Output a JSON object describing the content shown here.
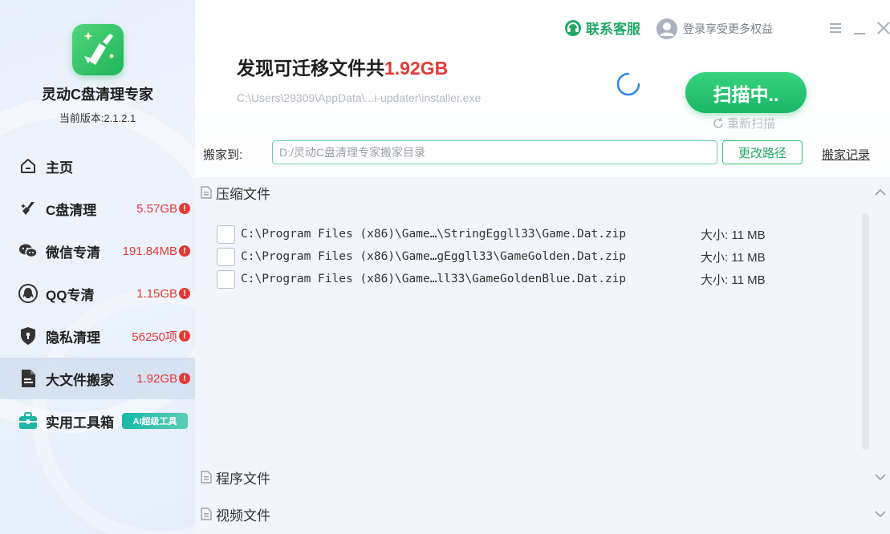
{
  "app": {
    "name": "灵动C盘清理专家",
    "version": "当前版本:2.1.2.1"
  },
  "sidebar": {
    "items": [
      {
        "label": "主页",
        "icon": "home-icon",
        "value": "",
        "active": false
      },
      {
        "label": "C盘清理",
        "icon": "broom-icon",
        "value": "5.57GB",
        "active": false
      },
      {
        "label": "微信专清",
        "icon": "wechat-icon",
        "value": "191.84MB",
        "active": false
      },
      {
        "label": "QQ专清",
        "icon": "qq-icon",
        "value": "1.15GB",
        "active": false
      },
      {
        "label": "隐私清理",
        "icon": "shield-icon",
        "value": "56250项",
        "active": false
      },
      {
        "label": "大文件搬家",
        "icon": "file-move-icon",
        "value": "1.92GB",
        "active": true
      },
      {
        "label": "实用工具箱",
        "icon": "toolbox-icon",
        "value": "",
        "tag": "AI超级工具",
        "active": false
      }
    ]
  },
  "topbar": {
    "service": "联系客服",
    "login": "登录享受更多权益"
  },
  "header": {
    "headline_prefix": "发现可迁移文件共",
    "headline_size": "1.92GB",
    "scan_path": "C:\\Users\\29309\\AppData\\...i-updater\\installer.exe",
    "scan_button": "扫描中..",
    "rescan": "重新扫描"
  },
  "move": {
    "label": "搬家到:",
    "path": "D:/灵动C盘清理专家搬家目录",
    "change_button": "更改路径",
    "log_link": "搬家记录"
  },
  "groups": [
    {
      "title": "压缩文件",
      "expanded": true,
      "files": [
        {
          "path": "C:\\Program Files (x86)\\Game…\\StringEggll33\\Game.Dat.zip",
          "size": "大小: 11 MB"
        },
        {
          "path": "C:\\Program Files (x86)\\Game…gEggll33\\GameGolden.Dat.zip",
          "size": "大小: 11 MB"
        },
        {
          "path": "C:\\Program Files (x86)\\Game…ll33\\GameGoldenBlue.Dat.zip",
          "size": "大小: 11 MB"
        }
      ]
    },
    {
      "title": "程序文件",
      "expanded": false
    },
    {
      "title": "视频文件",
      "expanded": false
    }
  ],
  "colors": {
    "accent_green": "#1fb566",
    "alert_red": "#e53935",
    "sidebar_active": "#d2def0"
  }
}
